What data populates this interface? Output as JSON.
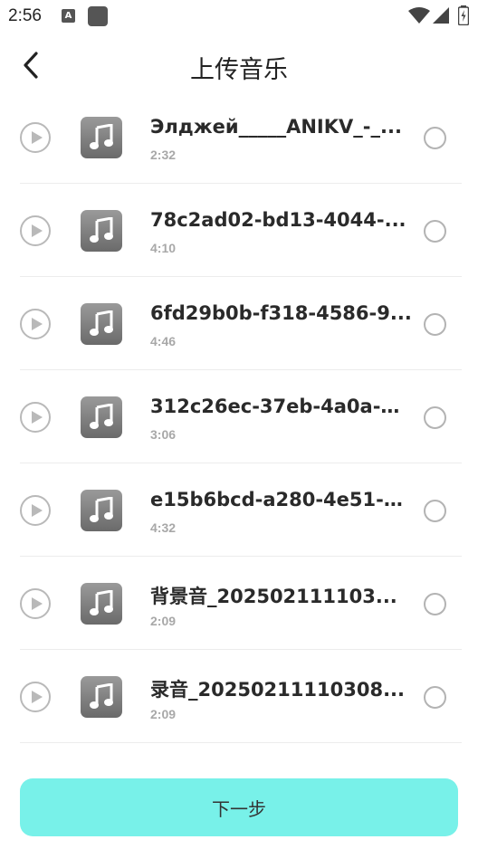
{
  "status_bar": {
    "time": "2:56",
    "notification_icons": [
      "a-icon",
      "square-icon"
    ],
    "right_icons": [
      "wifi-icon",
      "signal-icon",
      "battery-icon"
    ]
  },
  "header": {
    "back_icon": "chevron-left-icon",
    "title": "上传音乐"
  },
  "songs": [
    {
      "title": "Элджей_____ANIKV_-_...",
      "duration": "2:32"
    },
    {
      "title": "78c2ad02-bd13-4044-...",
      "duration": "4:10"
    },
    {
      "title": "6fd29b0b-f318-4586-9...",
      "duration": "4:46"
    },
    {
      "title": "312c26ec-37eb-4a0a-b...",
      "duration": "3:06"
    },
    {
      "title": "e15b6bcd-a280-4e51-b...",
      "duration": "4:32"
    },
    {
      "title": "背景音_202502111103...",
      "duration": "2:09"
    },
    {
      "title": "录音_20250211110308...",
      "duration": "2:09"
    }
  ],
  "footer": {
    "next_label": "下一步"
  },
  "colors": {
    "accent": "#78f1e9",
    "icon_gray": "#b9b9b9",
    "duration_gray": "#a8a8a8"
  }
}
